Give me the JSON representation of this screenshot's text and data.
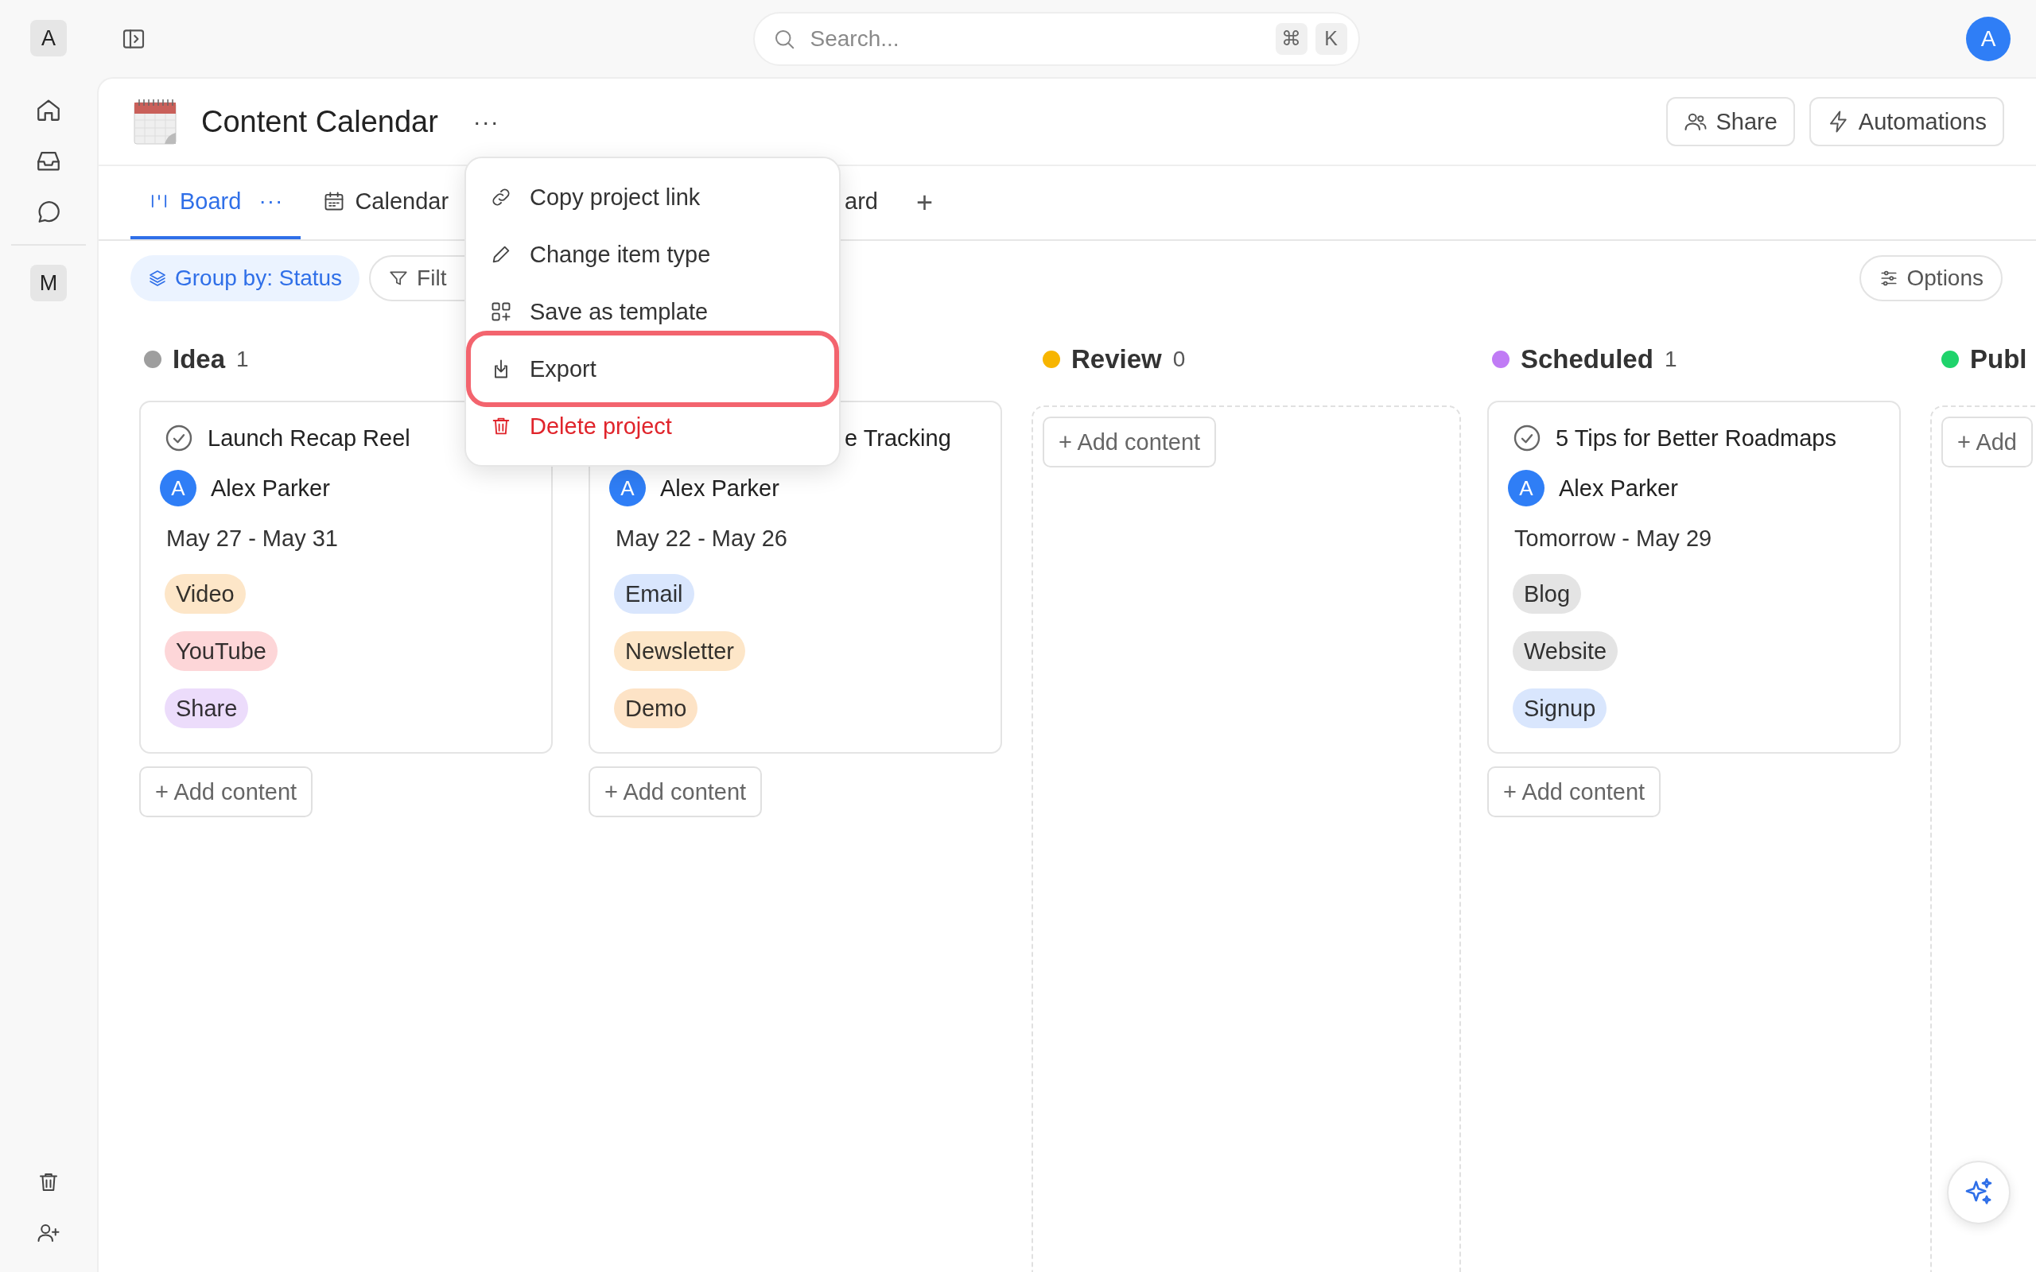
{
  "sidebar": {
    "workspace": "A",
    "space": "M"
  },
  "topbar": {
    "search": {
      "placeholder": "Search..."
    },
    "shortcut": [
      "⌘",
      "K"
    ],
    "avatar": "A"
  },
  "project": {
    "title": "Content Calendar",
    "more": "···"
  },
  "actions": [
    {
      "label": "Share",
      "kind": "share"
    },
    {
      "label": "Automations",
      "kind": "automations"
    }
  ],
  "tabs": [
    {
      "label": "Board",
      "kind": "board",
      "selected": true,
      "more": "···"
    },
    {
      "label": "Calendar",
      "kind": "calendar",
      "selected": false
    },
    {
      "label": "ard",
      "kind": "covered",
      "selected": false
    }
  ],
  "add_view": "+",
  "toolbar": {
    "group_by": "Group by: Status",
    "filter": "Filt",
    "options": "Options"
  },
  "menu": {
    "items": [
      {
        "label": "Copy project link",
        "kind": "link",
        "highlighted": false,
        "danger": false
      },
      {
        "label": "Change item type",
        "kind": "pencil",
        "highlighted": false,
        "danger": false
      },
      {
        "label": "Save as template",
        "kind": "template",
        "highlighted": false,
        "danger": false
      },
      {
        "label": "Export",
        "kind": "export",
        "highlighted": true,
        "danger": false
      },
      {
        "label": "Delete project",
        "kind": "trash",
        "highlighted": false,
        "danger": true
      }
    ]
  },
  "columns": [
    {
      "name": "Idea",
      "count": "1",
      "color": "#9e9e9e",
      "covered": false,
      "add": "+ Add content",
      "cards": [
        {
          "title": "Launch Recap Reel",
          "avatar": "A",
          "assignee": "Alex Parker",
          "dates": "May 27 - May 31",
          "tags": [
            {
              "label": "Video",
              "color": "#fde6c8"
            },
            {
              "label": "YouTube",
              "color": "#fdd6d8"
            },
            {
              "label": "Share",
              "color": "#ecdcfb"
            }
          ]
        }
      ]
    },
    {
      "covered": true,
      "add": "+ Add content",
      "cards": [
        {
          "title": "e Tracking",
          "avatar": "A",
          "assignee": "Alex Parker",
          "dates": "May 22 - May 26",
          "tags": [
            {
              "label": "Email",
              "color": "#d9e6fd"
            },
            {
              "label": "Newsletter",
              "color": "#fde6c8"
            },
            {
              "label": "Demo",
              "color": "#fde3c6"
            }
          ]
        }
      ]
    },
    {
      "name": "Review",
      "count": "0",
      "color": "#f7b500",
      "add": "+ Add content"
    },
    {
      "name": "Scheduled",
      "count": "1",
      "color": "#c07bf5",
      "covered": false,
      "add": "+ Add content",
      "cards": [
        {
          "title": "5 Tips for Better Roadmaps",
          "avatar": "A",
          "assignee": "Alex Parker",
          "dates": "Tomorrow - May 29",
          "tags": [
            {
              "label": "Blog",
              "color": "#e4e4e4"
            },
            {
              "label": "Website",
              "color": "#e4e4e4"
            },
            {
              "label": "Signup",
              "color": "#d9e6fd"
            }
          ]
        }
      ]
    },
    {
      "name": "Publ",
      "color": "#1fd36b",
      "add": "+ Add"
    }
  ]
}
